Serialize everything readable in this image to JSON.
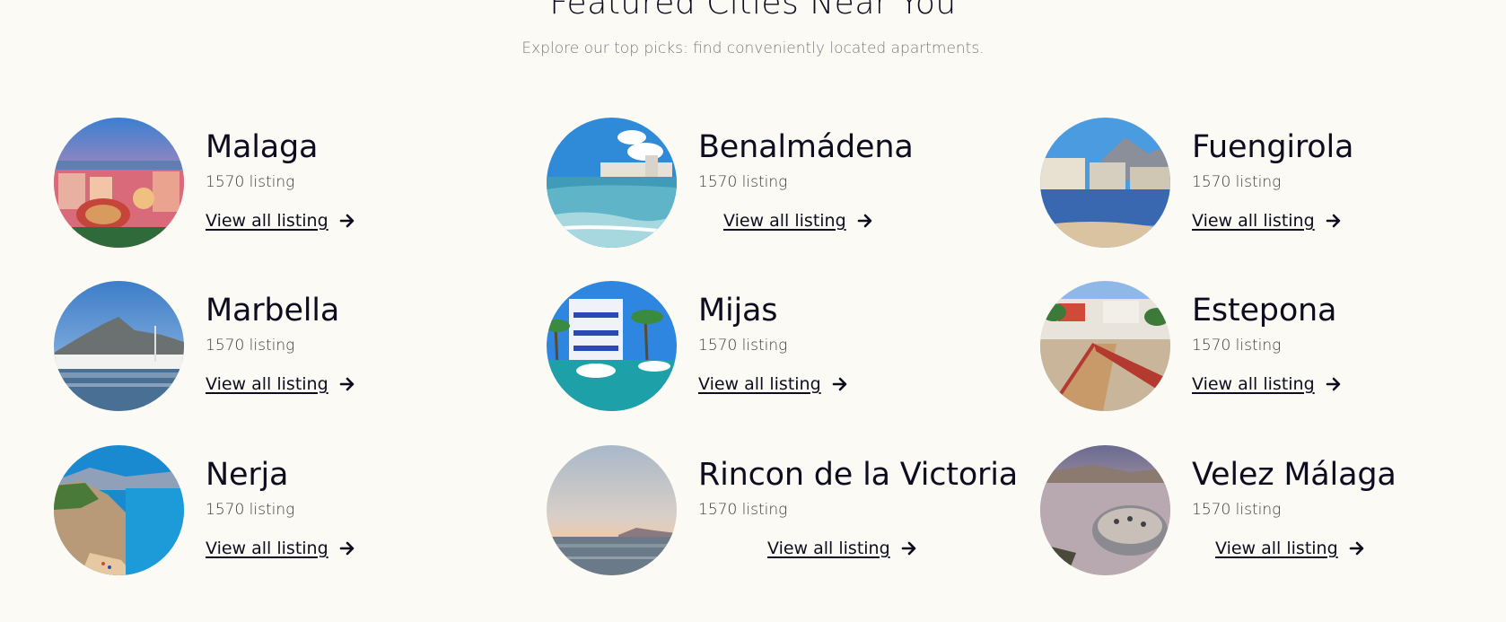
{
  "header": {
    "title": "Featured Cities Near You",
    "subtitle": "Explore our top picks: find conveniently located apartments."
  },
  "cities": [
    {
      "name": "Malaga",
      "count": "1570 listing",
      "link": "View all listing",
      "photo": "malaga-photo"
    },
    {
      "name": "Benalmádena",
      "count": "1570 listing",
      "link": "View all listing",
      "photo": "benalmadena-photo"
    },
    {
      "name": "Fuengirola",
      "count": "1570 listing",
      "link": "View all listing",
      "photo": "fuengirola-photo"
    },
    {
      "name": "Marbella",
      "count": "1570 listing",
      "link": "View all listing",
      "photo": "marbella-photo"
    },
    {
      "name": "Mijas",
      "count": "1570 listing",
      "link": "View all listing",
      "photo": "mijas-photo"
    },
    {
      "name": "Estepona",
      "count": "1570 listing",
      "link": "View all listing",
      "photo": "estepona-photo"
    },
    {
      "name": "Nerja",
      "count": "1570 listing",
      "link": "View all listing",
      "photo": "nerja-photo"
    },
    {
      "name": "Rincon de la Victoria",
      "count": "1570 listing",
      "link": "View all listing",
      "photo": "rincon-photo"
    },
    {
      "name": "Velez Málaga",
      "count": "1570 listing",
      "link": "View all listing",
      "photo": "velez-photo"
    }
  ],
  "icons": {
    "link_arrow": "arrow-right-icon"
  },
  "colors": {
    "background": "#fbfaf5",
    "heading": "#0d0d1f",
    "muted": "#7b7b80"
  }
}
